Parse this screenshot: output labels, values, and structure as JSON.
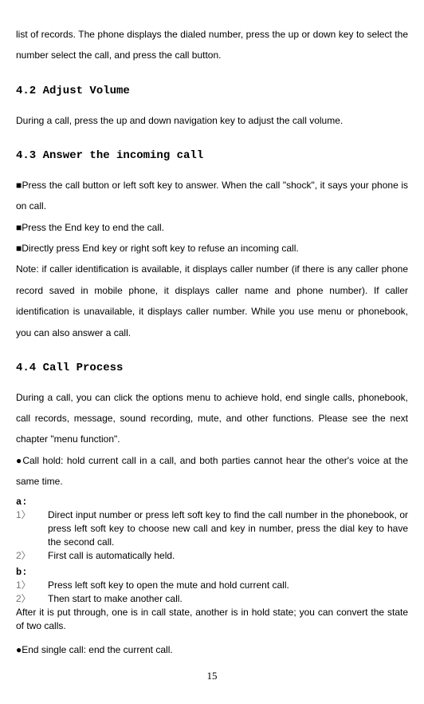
{
  "intro": "list of records. The phone displays the dialed number, press the up or down key to select the number select the call, and press the call button.",
  "h42": "4.2 Adjust Volume",
  "p42": "During a call, press the up and down navigation key to adjust the call volume.",
  "h43": "4.3 Answer the incoming call",
  "p43a": "■Press the call button or left soft key to answer. When the call \"shock\", it says your phone is on call.",
  "p43b": "■Press the End key to end the call.",
  "p43c": "■Directly press End key or right soft key to refuse an incoming call.",
  "p43note": "Note: if caller identification is available, it displays caller number (if there is any caller phone record saved in mobile phone, it displays caller name and phone number). If caller identification is unavailable, it displays caller number. While you use menu or phonebook, you can also answer a call.",
  "h44": "4.4 Call Process",
  "p44a": "During a call, you can click the options menu to achieve hold, end single calls, phonebook, call records, message, sound recording, mute, and other functions. Please see the next chapter \"menu function\".",
  "p44b": "●Call hold: hold current call in a call, and both parties cannot hear the other's voice at the same time.",
  "label_a": "a:",
  "a1": "Direct input number or press left soft key to find the call number in the phonebook, or press left soft key to choose new call and key in number, press the dial key to have the second call.",
  "a2": "First call is automatically held.",
  "label_b": "b:",
  "b1": "Press left soft key to open the mute and hold current call.",
  "b2": "Then start to make another call.",
  "after": "After it is put through, one is in call state, another is in hold state; you can convert the state of two calls.",
  "p44c": "●End single call: end the current call.",
  "page": "15",
  "n1": "1〉",
  "n2": "2〉"
}
